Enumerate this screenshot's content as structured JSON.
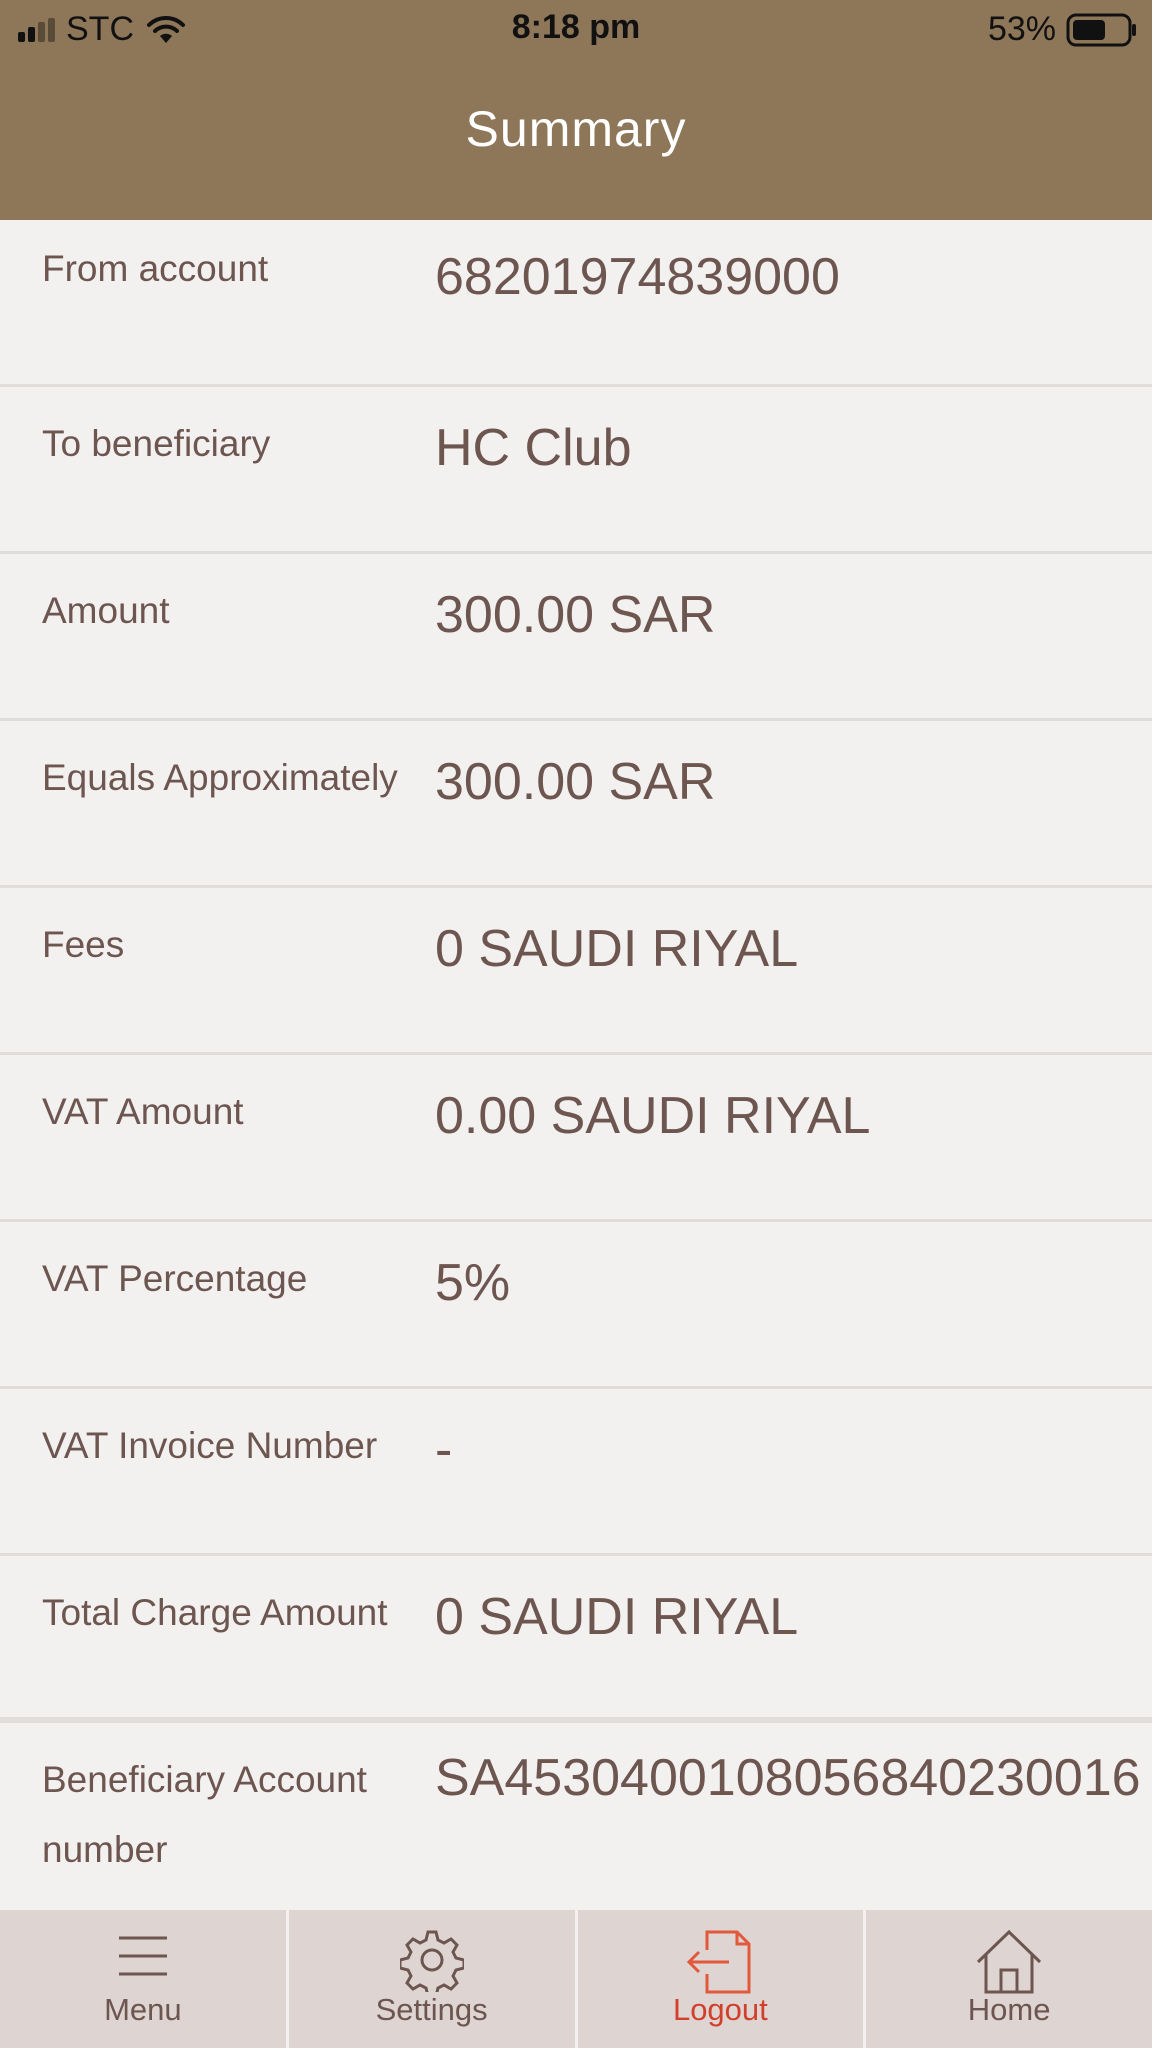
{
  "status_bar": {
    "carrier": "STC",
    "time": "8:18 pm",
    "battery": "53%"
  },
  "header": {
    "title": "Summary"
  },
  "summary_rows": [
    {
      "label": "From account",
      "value": "68201974839000"
    },
    {
      "label": "To beneficiary",
      "value": "HC Club"
    },
    {
      "label": "Amount",
      "value": "300.00 SAR"
    },
    {
      "label": "Equals Approximately",
      "value": "300.00 SAR"
    },
    {
      "label": "Fees",
      "value": "0 SAUDI RIYAL"
    },
    {
      "label": "VAT Amount",
      "value": "0.00 SAUDI RIYAL"
    },
    {
      "label": "VAT Percentage",
      "value": "5%"
    },
    {
      "label": "VAT Invoice Number",
      "value": "-"
    },
    {
      "label": "Total Charge Amount",
      "value": "0 SAUDI RIYAL"
    },
    {
      "label": "Beneficiary Account number",
      "value": "SA4530400108056840230016"
    }
  ],
  "tabbar": {
    "menu": "Menu",
    "settings": "Settings",
    "logout": "Logout",
    "home": "Home"
  },
  "colors": {
    "header_bg": "#8e7658",
    "text": "#6d5550",
    "active_tab": "#d2402c",
    "tabbar_bg": "#ded4d2"
  }
}
